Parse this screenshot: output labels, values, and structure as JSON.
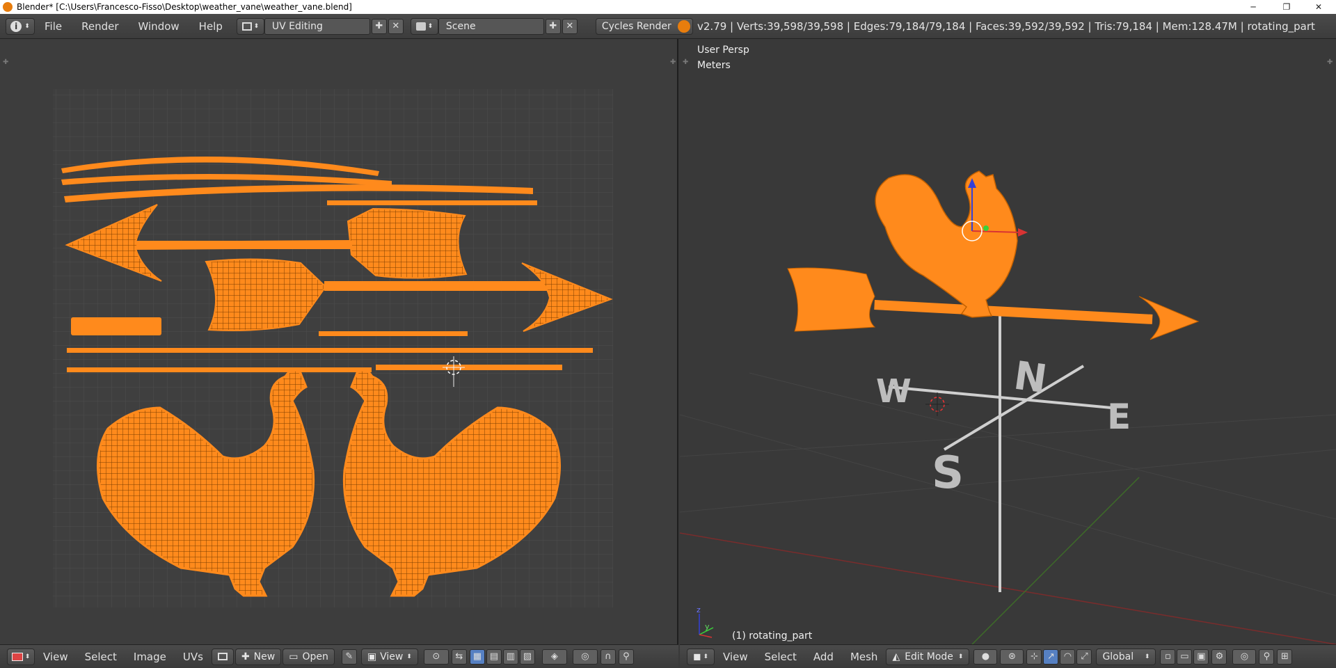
{
  "window": {
    "title": "Blender* [C:\\Users\\Francesco-Fisso\\Desktop\\weather_vane\\weather_vane.blend]",
    "minimize": "─",
    "restore": "❐",
    "close": "✕"
  },
  "infobar": {
    "menus": [
      "File",
      "Render",
      "Window",
      "Help"
    ],
    "screen_layout": "UV Editing",
    "scene": "Scene",
    "render_engine": "Cycles Render",
    "stats": "v2.79 | Verts:39,598/39,598 | Edges:79,184/79,184 | Faces:39,592/39,592 | Tris:79,184 | Mem:128.47M | rotating_part"
  },
  "viewport": {
    "view_name": "User Persp",
    "units": "Meters",
    "object_label": "(1) rotating_part",
    "compass": [
      "W",
      "N",
      "S",
      "E"
    ]
  },
  "uv_header": {
    "menus": [
      "View",
      "Select",
      "Image",
      "UVs"
    ],
    "new_label": "New",
    "open_label": "Open",
    "view_label": "View"
  },
  "view3d_header": {
    "menus": [
      "View",
      "Select",
      "Add",
      "Mesh"
    ],
    "mode": "Edit Mode",
    "orientation": "Global"
  },
  "colors": {
    "accent": "#ff8a1c",
    "background": "#393939",
    "grid": "#4a4a4a"
  }
}
